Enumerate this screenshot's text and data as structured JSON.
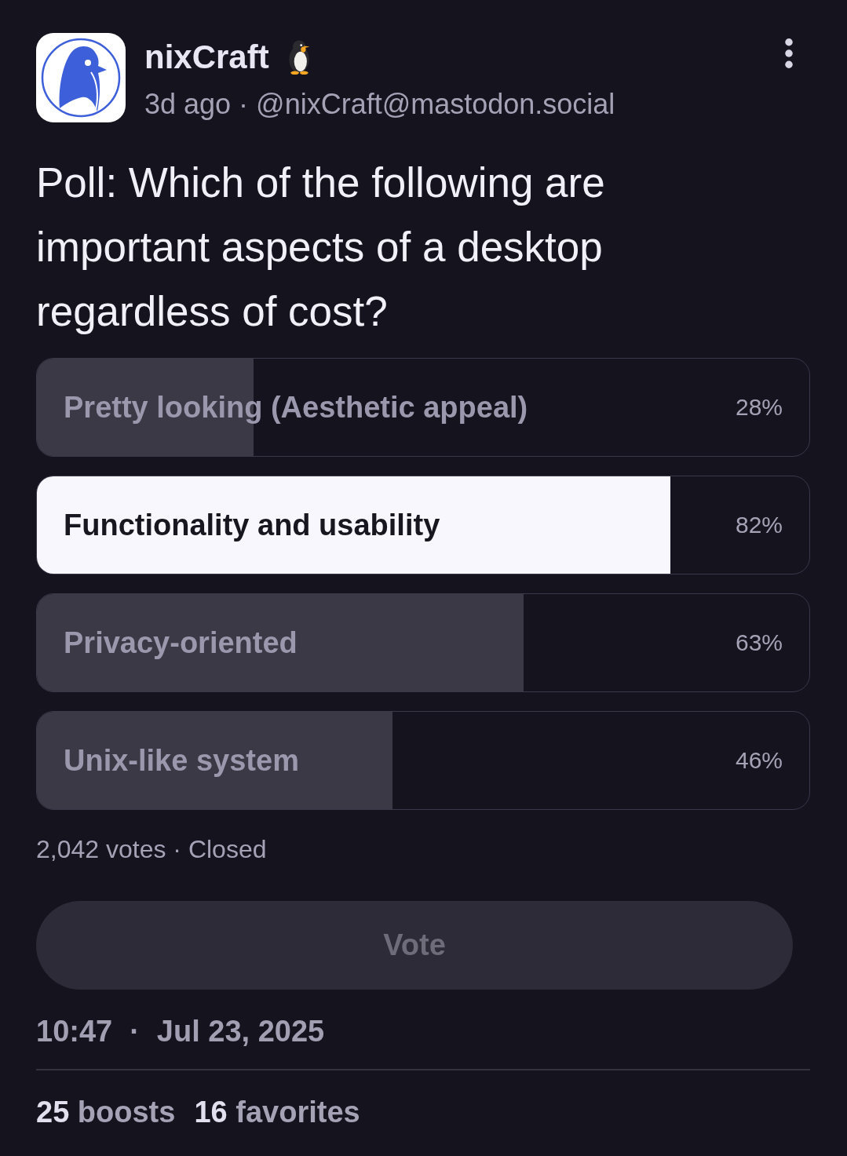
{
  "author": {
    "name": "nixCraft",
    "meta": "3d ago · @nixCraft@mastodon.social"
  },
  "question": "Poll: Which of the following are important aspects of a desktop regardless of cost?",
  "poll": {
    "options": [
      {
        "label": "Pretty looking (Aesthetic appeal)",
        "percent": "28%",
        "level": 0.28,
        "leading": false
      },
      {
        "label": "Functionality and usability",
        "percent": "82%",
        "level": 0.82,
        "leading": true
      },
      {
        "label": "Privacy-oriented",
        "percent": "63%",
        "level": 0.63,
        "leading": false
      },
      {
        "label": "Unix-like system",
        "percent": "46%",
        "level": 0.46,
        "leading": false
      }
    ],
    "summary": "2,042 votes · Closed",
    "vote_button": {
      "label": "Vote",
      "disabled": true
    }
  },
  "timestamp": {
    "time": "10:47",
    "separator": "·",
    "date": "Jul 23, 2025"
  },
  "stats": [
    {
      "count": "25",
      "label": "boosts"
    },
    {
      "count": "16",
      "label": "favorites"
    }
  ]
}
